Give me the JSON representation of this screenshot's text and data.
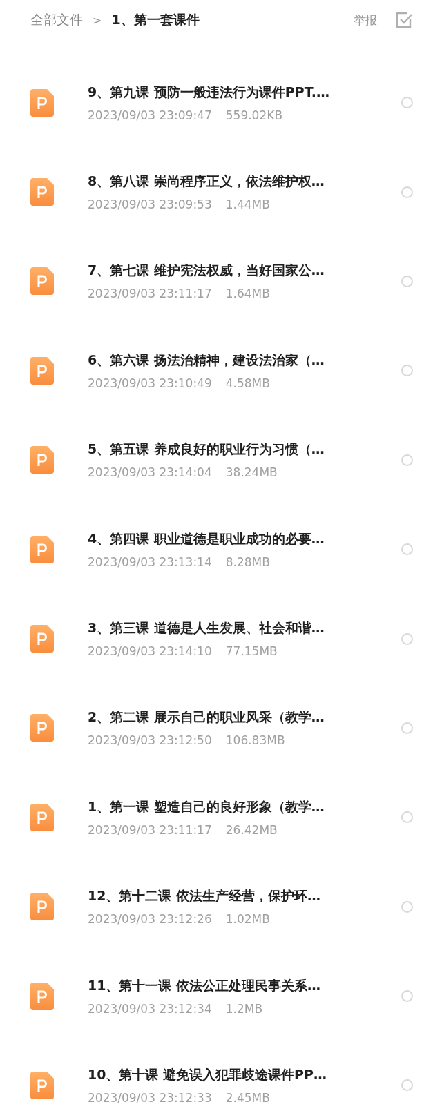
{
  "breadcrumb": {
    "root": "全部文件",
    "separator": ">",
    "current": "1、第一套课件"
  },
  "actions": {
    "report": "举报"
  },
  "files": [
    {
      "name": "9、第九课 预防一般违法行为课件PPT.…",
      "date": "2023/09/03 23:09:47",
      "size": "559.02KB",
      "selected": false
    },
    {
      "name": "8、第八课 崇尚程序正义，依法维护权…",
      "date": "2023/09/03 23:09:53",
      "size": "1.44MB",
      "selected": false
    },
    {
      "name": "7、第七课 维护宪法权威，当好国家公…",
      "date": "2023/09/03 23:11:17",
      "size": "1.64MB",
      "selected": false
    },
    {
      "name": "6、第六课 扬法治精神，建设法治家（…",
      "date": "2023/09/03 23:10:49",
      "size": "4.58MB",
      "selected": false
    },
    {
      "name": "5、第五课 养成良好的职业行为习惯（…",
      "date": "2023/09/03 23:14:04",
      "size": "38.24MB",
      "selected": false
    },
    {
      "name": "4、第四课 职业道德是职业成功的必要…",
      "date": "2023/09/03 23:13:14",
      "size": "8.28MB",
      "selected": false
    },
    {
      "name": "3、第三课 道德是人生发展、社会和谐…",
      "date": "2023/09/03 23:14:10",
      "size": "77.15MB",
      "selected": false
    },
    {
      "name": "2、第二课 展示自己的职业风采（教学…",
      "date": "2023/09/03 23:12:50",
      "size": "106.83MB",
      "selected": false
    },
    {
      "name": "1、第一课 塑造自己的良好形象（教学…",
      "date": "2023/09/03 23:11:17",
      "size": "26.42MB",
      "selected": false
    },
    {
      "name": "12、第十二课 依法生产经营，保护环…",
      "date": "2023/09/03 23:12:26",
      "size": "1.02MB",
      "selected": false
    },
    {
      "name": "11、第十一课 依法公正处理民事关系…",
      "date": "2023/09/03 23:12:34",
      "size": "1.2MB",
      "selected": false
    },
    {
      "name": "10、第十课 避免误入犯罪歧途课件PP…",
      "date": "2023/09/03 23:12:33",
      "size": "2.45MB",
      "selected": false
    }
  ]
}
